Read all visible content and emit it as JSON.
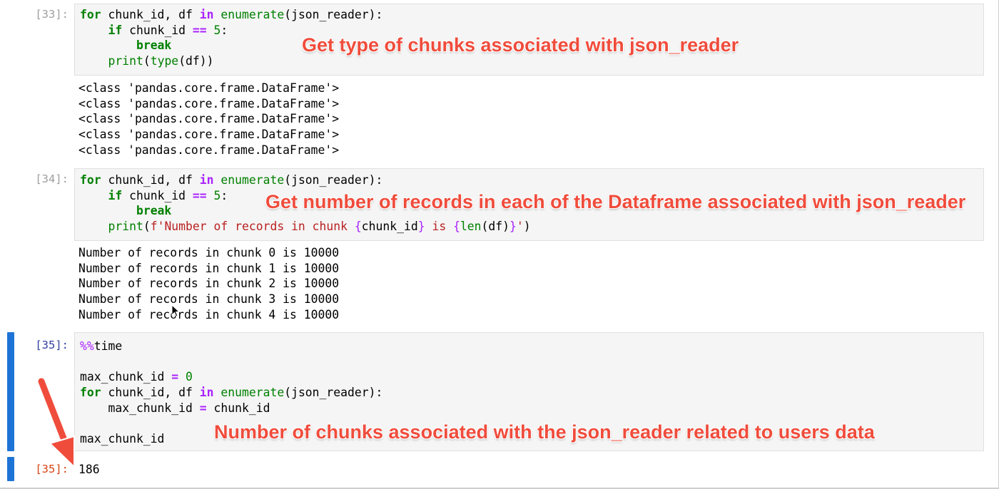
{
  "cells": [
    {
      "prompt": "[33]:",
      "code": [
        "for chunk_id, df in enumerate(json_reader):",
        "    if chunk_id == 5:",
        "        break",
        "    print(type(df))"
      ],
      "output": [
        "<class 'pandas.core.frame.DataFrame'>",
        "<class 'pandas.core.frame.DataFrame'>",
        "<class 'pandas.core.frame.DataFrame'>",
        "<class 'pandas.core.frame.DataFrame'>",
        "<class 'pandas.core.frame.DataFrame'>"
      ],
      "annotation": "Get type of chunks associated with json_reader"
    },
    {
      "prompt": "[34]:",
      "code": [
        "for chunk_id, df in enumerate(json_reader):",
        "    if chunk_id == 5:",
        "        break",
        "    print(f'Number of records in chunk {chunk_id} is {len(df)}')"
      ],
      "output": [
        "Number of records in chunk 0 is 10000",
        "Number of records in chunk 1 is 10000",
        "Number of records in chunk 2 is 10000",
        "Number of records in chunk 3 is 10000",
        "Number of records in chunk 4 is 10000"
      ],
      "annotation": "Get number of records in each of the Dataframe associated with json_reader"
    },
    {
      "prompt": "[35]:",
      "code": [
        "%%time",
        "",
        "max_chunk_id = 0",
        "for chunk_id, df in enumerate(json_reader):",
        "    max_chunk_id = chunk_id",
        "",
        "max_chunk_id"
      ],
      "out_prompt": "[35]:",
      "result": "186",
      "annotation": "Number of chunks associated with the json_reader related to users data"
    }
  ],
  "colors": {
    "annotation": "#f04c3c",
    "selection_bar": "#1e74d6",
    "keyword": "#008000",
    "operator": "#aa22ff",
    "string": "#ba2121",
    "out_prompt": "#d84315",
    "active_prompt": "#303f9f"
  },
  "icons": [
    "mouse-pointer-icon",
    "red-arrow-icon"
  ]
}
